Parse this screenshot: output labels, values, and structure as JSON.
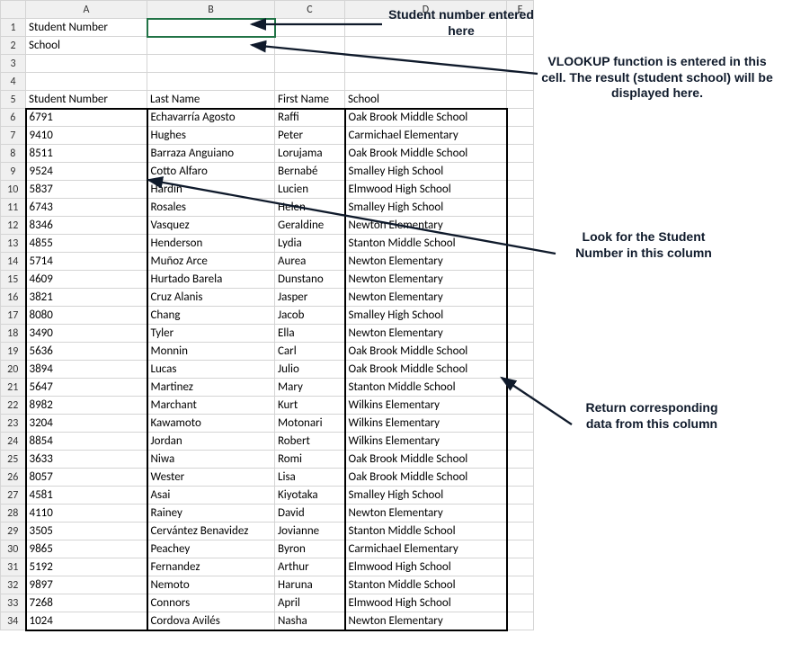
{
  "columns": [
    "A",
    "B",
    "C",
    "D",
    "E"
  ],
  "labels": {
    "student_number_label": "Student Number",
    "school_label": "School"
  },
  "headers": {
    "col_a": "Student Number",
    "col_b": "Last Name",
    "col_c": "First Name",
    "col_d": "School"
  },
  "rows": [
    {
      "num": "6791",
      "last": "Echavarría Agosto",
      "first": "Raffi",
      "school": "Oak Brook Middle School"
    },
    {
      "num": "9410",
      "last": "Hughes",
      "first": "Peter",
      "school": "Carmichael Elementary"
    },
    {
      "num": "8511",
      "last": "Barraza Anguiano",
      "first": "Lorujama",
      "school": "Oak Brook Middle School"
    },
    {
      "num": "9524",
      "last": "Cotto Alfaro",
      "first": "Bernabé",
      "school": "Smalley High School"
    },
    {
      "num": "5837",
      "last": "Hardin",
      "first": "Lucien",
      "school": "Elmwood High School"
    },
    {
      "num": "6743",
      "last": "Rosales",
      "first": "Helen",
      "school": "Smalley High School"
    },
    {
      "num": "8346",
      "last": "Vasquez",
      "first": "Geraldine",
      "school": "Newton Elementary"
    },
    {
      "num": "4855",
      "last": "Henderson",
      "first": "Lydia",
      "school": "Stanton Middle School"
    },
    {
      "num": "5714",
      "last": "Muñoz Arce",
      "first": "Aurea",
      "school": "Newton Elementary"
    },
    {
      "num": "4609",
      "last": "Hurtado Barela",
      "first": "Dunstano",
      "school": "Newton Elementary"
    },
    {
      "num": "3821",
      "last": "Cruz Alanis",
      "first": "Jasper",
      "school": "Newton Elementary"
    },
    {
      "num": "8080",
      "last": "Chang",
      "first": "Jacob",
      "school": "Smalley High School"
    },
    {
      "num": "3490",
      "last": "Tyler",
      "first": "Ella",
      "school": "Newton Elementary"
    },
    {
      "num": "5636",
      "last": "Monnin",
      "first": "Carl",
      "school": "Oak Brook Middle School"
    },
    {
      "num": "3894",
      "last": "Lucas",
      "first": "Julio",
      "school": "Oak Brook Middle School"
    },
    {
      "num": "5647",
      "last": "Martinez",
      "first": "Mary",
      "school": "Stanton Middle School"
    },
    {
      "num": "8982",
      "last": "Marchant",
      "first": "Kurt",
      "school": "Wilkins Elementary"
    },
    {
      "num": "3204",
      "last": "Kawamoto",
      "first": "Motonari",
      "school": "Wilkins Elementary"
    },
    {
      "num": "8854",
      "last": "Jordan",
      "first": "Robert",
      "school": "Wilkins Elementary"
    },
    {
      "num": "3633",
      "last": "Niwa",
      "first": "Romi",
      "school": "Oak Brook Middle School"
    },
    {
      "num": "8057",
      "last": "Wester",
      "first": "Lisa",
      "school": "Oak Brook Middle School"
    },
    {
      "num": "4581",
      "last": "Asai",
      "first": "Kiyotaka",
      "school": "Smalley High School"
    },
    {
      "num": "4110",
      "last": "Rainey",
      "first": "David",
      "school": "Newton Elementary"
    },
    {
      "num": "3505",
      "last": "Cervántez Benavidez",
      "first": "Jovianne",
      "school": "Stanton Middle School"
    },
    {
      "num": "9865",
      "last": "Peachey",
      "first": "Byron",
      "school": "Carmichael Elementary"
    },
    {
      "num": "5192",
      "last": "Fernandez",
      "first": "Arthur",
      "school": "Elmwood High School"
    },
    {
      "num": "9897",
      "last": "Nemoto",
      "first": "Haruna",
      "school": "Stanton Middle School"
    },
    {
      "num": "7268",
      "last": "Connors",
      "first": "April",
      "school": "Elmwood High School"
    },
    {
      "num": "1024",
      "last": "Cordova Avilés",
      "first": "Nasha",
      "school": "Newton Elementary"
    }
  ],
  "annotations": {
    "a1": "Student number entered here",
    "a2": "VLOOKUP function is entered in this cell. The result (student school) will be displayed here.",
    "a3": "Look for the Student Number in this column",
    "a4": "Return corresponding data from this column"
  }
}
